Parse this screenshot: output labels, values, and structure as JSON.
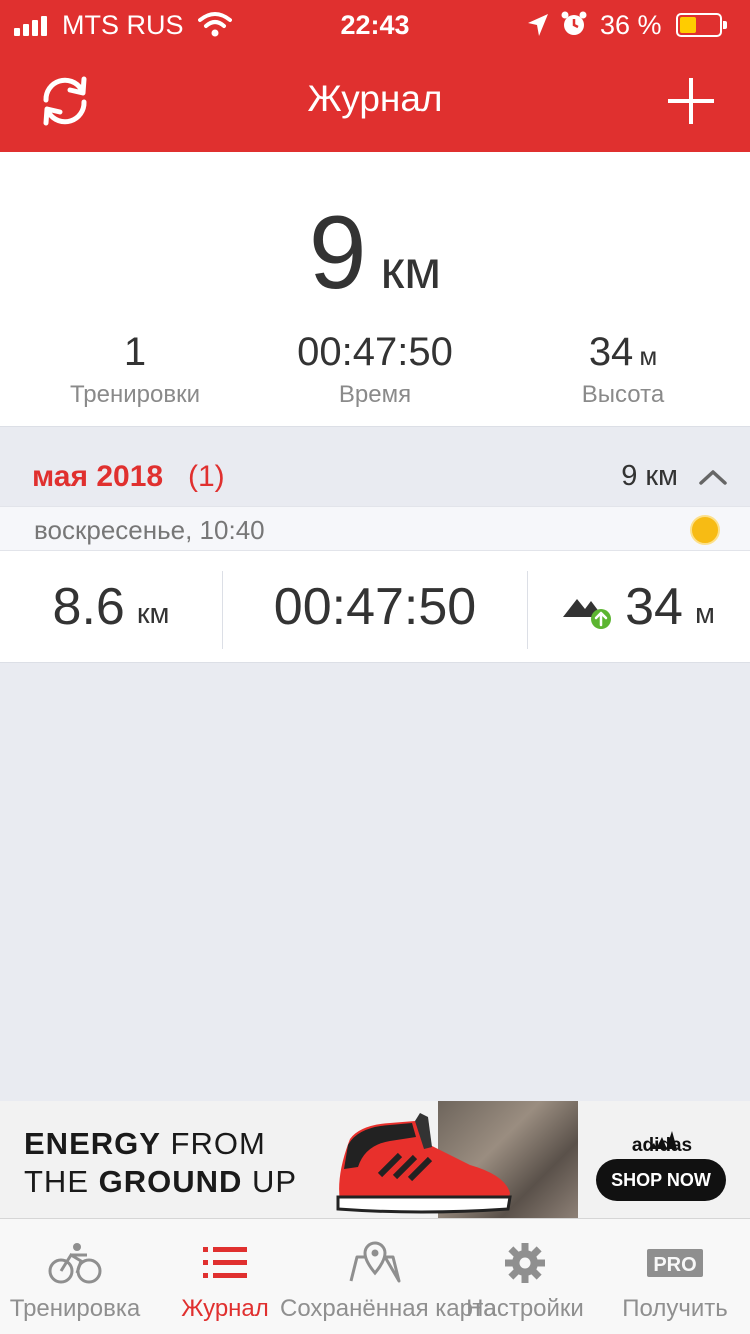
{
  "status_bar": {
    "carrier": "MTS RUS",
    "time": "22:43",
    "battery_percent": "36 %",
    "battery_level": 0.36
  },
  "header": {
    "title": "Журнал",
    "refresh_icon": "refresh-icon",
    "add_icon": "plus-icon"
  },
  "summary": {
    "total_distance": "9",
    "total_unit": "км",
    "workouts_value": "1",
    "workouts_label": "Тренировки",
    "time_value": "00:47:50",
    "time_label": "Время",
    "elevation_value": "34",
    "elevation_unit": "м",
    "elevation_label": "Высота"
  },
  "month": {
    "label": "мая 2018",
    "count": "(1)",
    "total": "9 км"
  },
  "day": {
    "label": "воскресенье, 10:40",
    "weather_icon": "sun-icon"
  },
  "workout": {
    "distance": "8.6",
    "distance_unit": "км",
    "duration": "00:47:50",
    "elevation": "34",
    "elevation_unit": "м"
  },
  "ad": {
    "line1_bold": "ENERGY",
    "line1_rest": " FROM",
    "line2_pre": "THE ",
    "line2_bold": "GROUND",
    "line2_rest": " UP",
    "brand": "adidas",
    "cta": "SHOP NOW"
  },
  "tabs": [
    {
      "label": "Тренировка",
      "icon": "cycling-icon",
      "active": false
    },
    {
      "label": "Журнал",
      "icon": "list-icon",
      "active": true
    },
    {
      "label": "Сохранённая карта",
      "icon": "map-icon",
      "active": false
    },
    {
      "label": "Настройки",
      "icon": "gear-icon",
      "active": false
    },
    {
      "label": "Получить",
      "icon": "pro-icon",
      "active": false
    }
  ],
  "colors": {
    "accent": "#e0302f",
    "background": "#e9ebf1",
    "sun": "#f7bb14",
    "climb_badge": "#5cb531"
  }
}
